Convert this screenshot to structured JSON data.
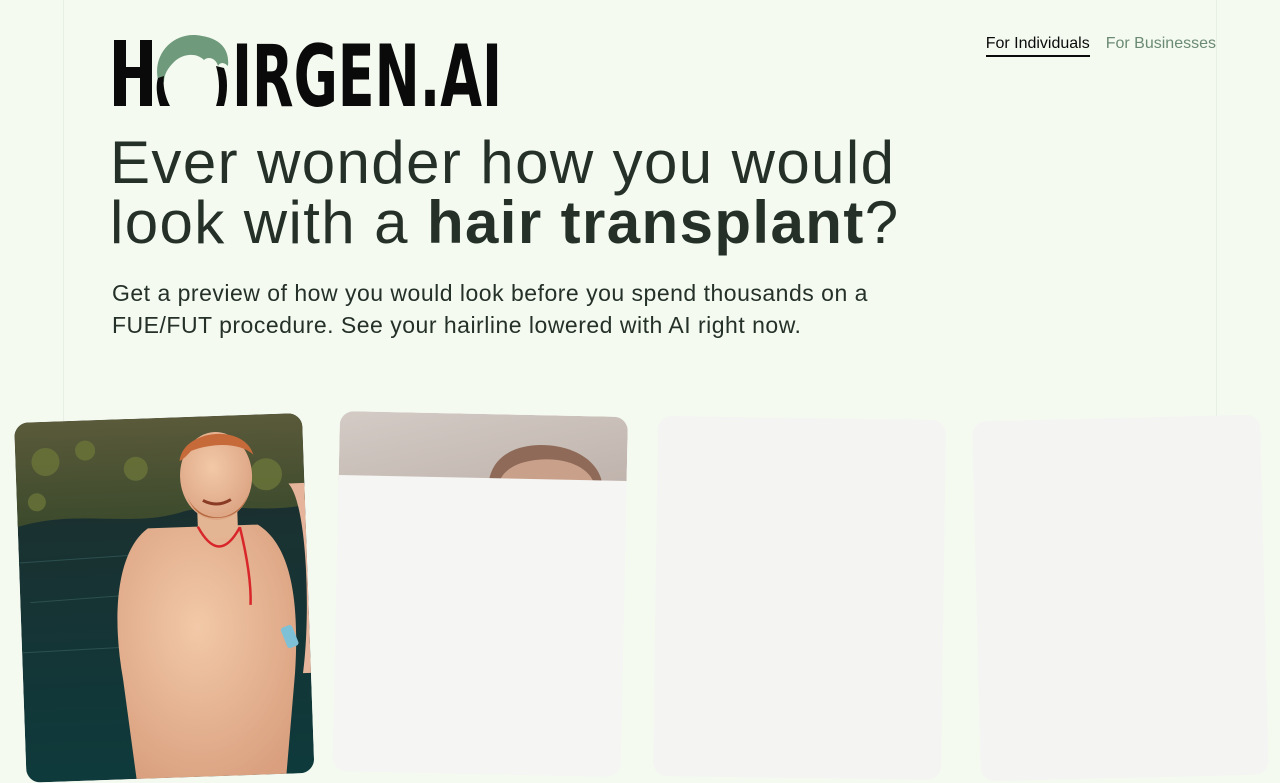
{
  "brand": {
    "logo_text": "HAIRGEN.AI",
    "logo_part_before_icon": "H",
    "logo_part_after_icon": "IRGEN.AI",
    "icon": "hair-tuft-icon",
    "icon_color": "#6f9a7c"
  },
  "nav": {
    "items": [
      {
        "label": "For Individuals",
        "active": true
      },
      {
        "label": "For Businesses",
        "active": false
      }
    ]
  },
  "hero": {
    "headline_line1": "Ever wonder how you would",
    "headline_line2_prefix": "look with a ",
    "headline_emphasis": "hair transplant",
    "headline_suffix": "?",
    "subheadline": "Get a preview of how you would look before you spend thousands on a FUE/FUT procedure. See your hairline lowered with AI right now."
  },
  "gallery": {
    "cards": [
      {
        "content": "photo",
        "subject": "man-in-water-photo"
      },
      {
        "content": "loading-photo",
        "subject": "partial-face-photo"
      },
      {
        "content": "placeholder"
      },
      {
        "content": "placeholder"
      }
    ]
  },
  "colors": {
    "background": "#f4faf0",
    "text": "#243028",
    "accent": "#6f9a7c",
    "nav_inactive": "#6b8a74",
    "card_placeholder": "#f4f4f3"
  }
}
